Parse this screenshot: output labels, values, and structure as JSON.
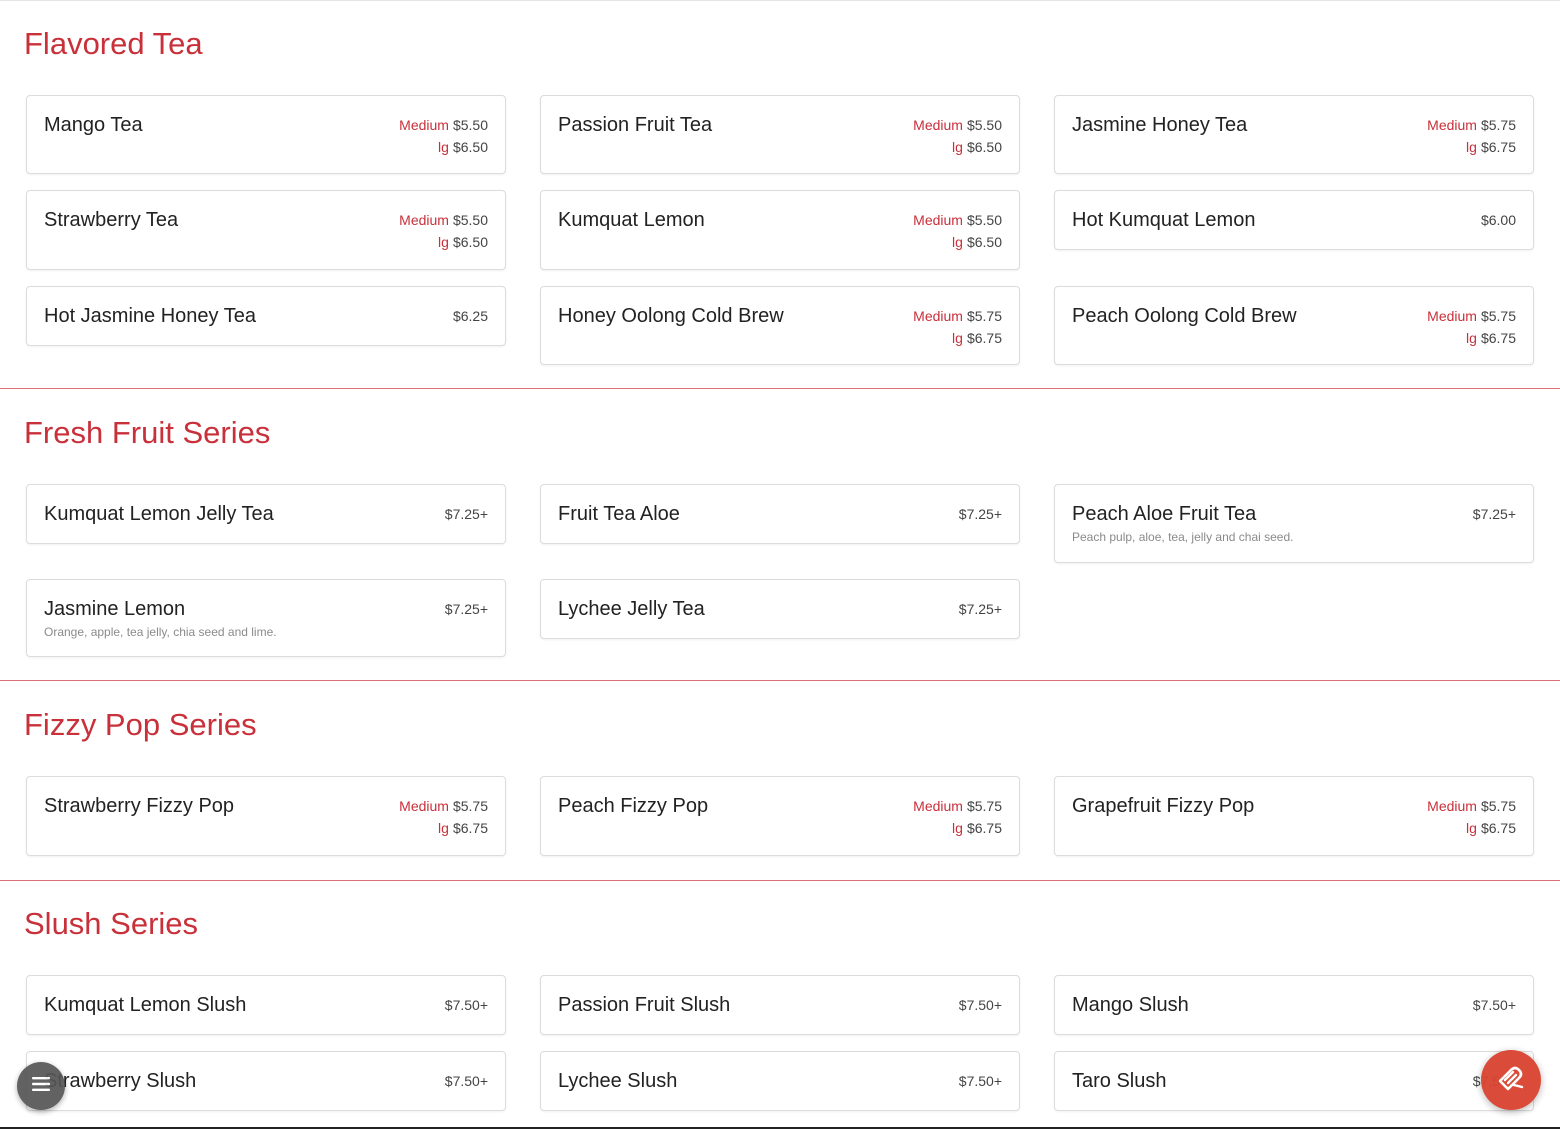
{
  "sections": [
    {
      "title": "Flavored Tea",
      "items": [
        {
          "name": "Mango Tea",
          "prices": [
            {
              "size": "Medium",
              "price": "$5.50"
            },
            {
              "size": "lg",
              "price": "$6.50"
            }
          ]
        },
        {
          "name": "Passion Fruit Tea",
          "prices": [
            {
              "size": "Medium",
              "price": "$5.50"
            },
            {
              "size": "lg",
              "price": "$6.50"
            }
          ]
        },
        {
          "name": "Jasmine Honey Tea",
          "prices": [
            {
              "size": "Medium",
              "price": "$5.75"
            },
            {
              "size": "lg",
              "price": "$6.75"
            }
          ]
        },
        {
          "name": "Strawberry Tea",
          "prices": [
            {
              "size": "Medium",
              "price": "$5.50"
            },
            {
              "size": "lg",
              "price": "$6.50"
            }
          ]
        },
        {
          "name": "Kumquat Lemon",
          "prices": [
            {
              "size": "Medium",
              "price": "$5.50"
            },
            {
              "size": "lg",
              "price": "$6.50"
            }
          ]
        },
        {
          "name": "Hot Kumquat Lemon",
          "prices": [
            {
              "size": "",
              "price": "$6.00"
            }
          ]
        },
        {
          "name": "Hot Jasmine Honey Tea",
          "prices": [
            {
              "size": "",
              "price": "$6.25"
            }
          ]
        },
        {
          "name": "Honey Oolong Cold Brew",
          "prices": [
            {
              "size": "Medium",
              "price": "$5.75"
            },
            {
              "size": "lg",
              "price": "$6.75"
            }
          ]
        },
        {
          "name": "Peach Oolong Cold Brew",
          "prices": [
            {
              "size": "Medium",
              "price": "$5.75"
            },
            {
              "size": "lg",
              "price": "$6.75"
            }
          ]
        }
      ]
    },
    {
      "title": "Fresh Fruit Series",
      "items": [
        {
          "name": "Kumquat Lemon Jelly Tea",
          "prices": [
            {
              "size": "",
              "price": "$7.25+"
            }
          ]
        },
        {
          "name": "Fruit Tea Aloe",
          "prices": [
            {
              "size": "",
              "price": "$7.25+"
            }
          ]
        },
        {
          "name": "Peach Aloe Fruit Tea",
          "desc": "Peach pulp, aloe, tea, jelly and chai seed.",
          "prices": [
            {
              "size": "",
              "price": "$7.25+"
            }
          ]
        },
        {
          "name": "Jasmine Lemon",
          "desc": "Orange, apple, tea jelly, chia seed and lime.",
          "prices": [
            {
              "size": "",
              "price": "$7.25+"
            }
          ]
        },
        {
          "name": "Lychee Jelly Tea",
          "prices": [
            {
              "size": "",
              "price": "$7.25+"
            }
          ]
        }
      ]
    },
    {
      "title": "Fizzy Pop Series",
      "items": [
        {
          "name": "Strawberry Fizzy Pop",
          "prices": [
            {
              "size": "Medium",
              "price": "$5.75"
            },
            {
              "size": "lg",
              "price": "$6.75"
            }
          ]
        },
        {
          "name": "Peach Fizzy Pop",
          "prices": [
            {
              "size": "Medium",
              "price": "$5.75"
            },
            {
              "size": "lg",
              "price": "$6.75"
            }
          ]
        },
        {
          "name": "Grapefruit Fizzy Pop",
          "prices": [
            {
              "size": "Medium",
              "price": "$5.75"
            },
            {
              "size": "lg",
              "price": "$6.75"
            }
          ]
        }
      ]
    },
    {
      "title": "Slush Series",
      "items": [
        {
          "name": "Kumquat Lemon Slush",
          "prices": [
            {
              "size": "",
              "price": "$7.50+"
            }
          ]
        },
        {
          "name": "Passion Fruit Slush",
          "prices": [
            {
              "size": "",
              "price": "$7.50+"
            }
          ]
        },
        {
          "name": "Mango Slush",
          "prices": [
            {
              "size": "",
              "price": "$7.50+"
            }
          ]
        },
        {
          "name": "Strawberry Slush",
          "prices": [
            {
              "size": "",
              "price": "$7.50+"
            }
          ]
        },
        {
          "name": "Lychee Slush",
          "prices": [
            {
              "size": "",
              "price": "$7.50+"
            }
          ]
        },
        {
          "name": "Taro Slush",
          "prices": [
            {
              "size": "",
              "price": "$7.50+"
            }
          ]
        }
      ]
    }
  ],
  "icons": {
    "menu_fab": "menu-icon",
    "order_fab": "order-icon"
  },
  "colors": {
    "accent": "#c8303a",
    "fab_order": "#d9432f",
    "fab_menu": "#555555"
  }
}
